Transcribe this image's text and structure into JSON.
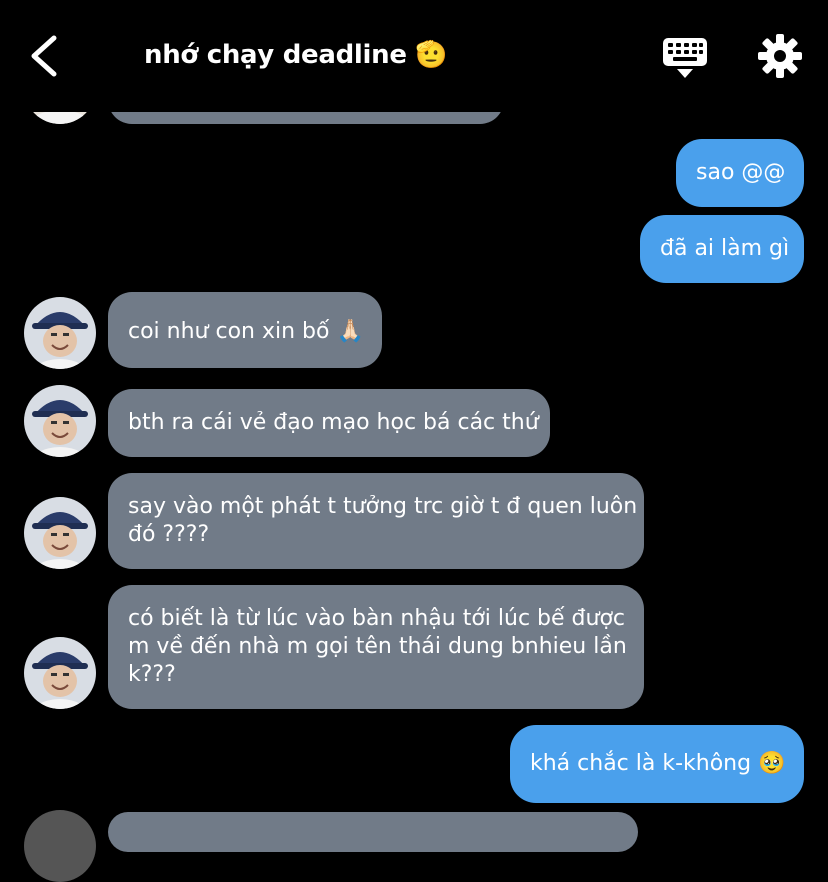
{
  "header": {
    "title": "nhớ chạy deadline 🫡"
  },
  "messages": [
    {
      "side": "out",
      "text": "sao @@"
    },
    {
      "side": "out",
      "text": "đã ai làm gì"
    },
    {
      "side": "in",
      "text": "coi như con xin bố 🙏🏻"
    },
    {
      "side": "in",
      "text": "bth ra cái vẻ đạo mạo học bá các thứ"
    },
    {
      "side": "in",
      "line1": "say vào một phát t tưởng trc giờ t đ quen luôn",
      "line2": "đó ????"
    },
    {
      "side": "in",
      "line1": "có biết là từ lúc vào bàn nhậu tới lúc bế được",
      "line2": "m về đến nhà m gọi tên thái dung bnhieu lần",
      "line3": "k???"
    },
    {
      "side": "out",
      "text": "khá chắc là k-không 🥹"
    }
  ],
  "colors": {
    "background": "#000000",
    "incoming_bubble": "#717b88",
    "outgoing_bubble": "#4aa0ec"
  },
  "icons": {
    "back": "chevron-left-icon",
    "keyboard": "keyboard-icon",
    "settings": "gear-icon"
  }
}
